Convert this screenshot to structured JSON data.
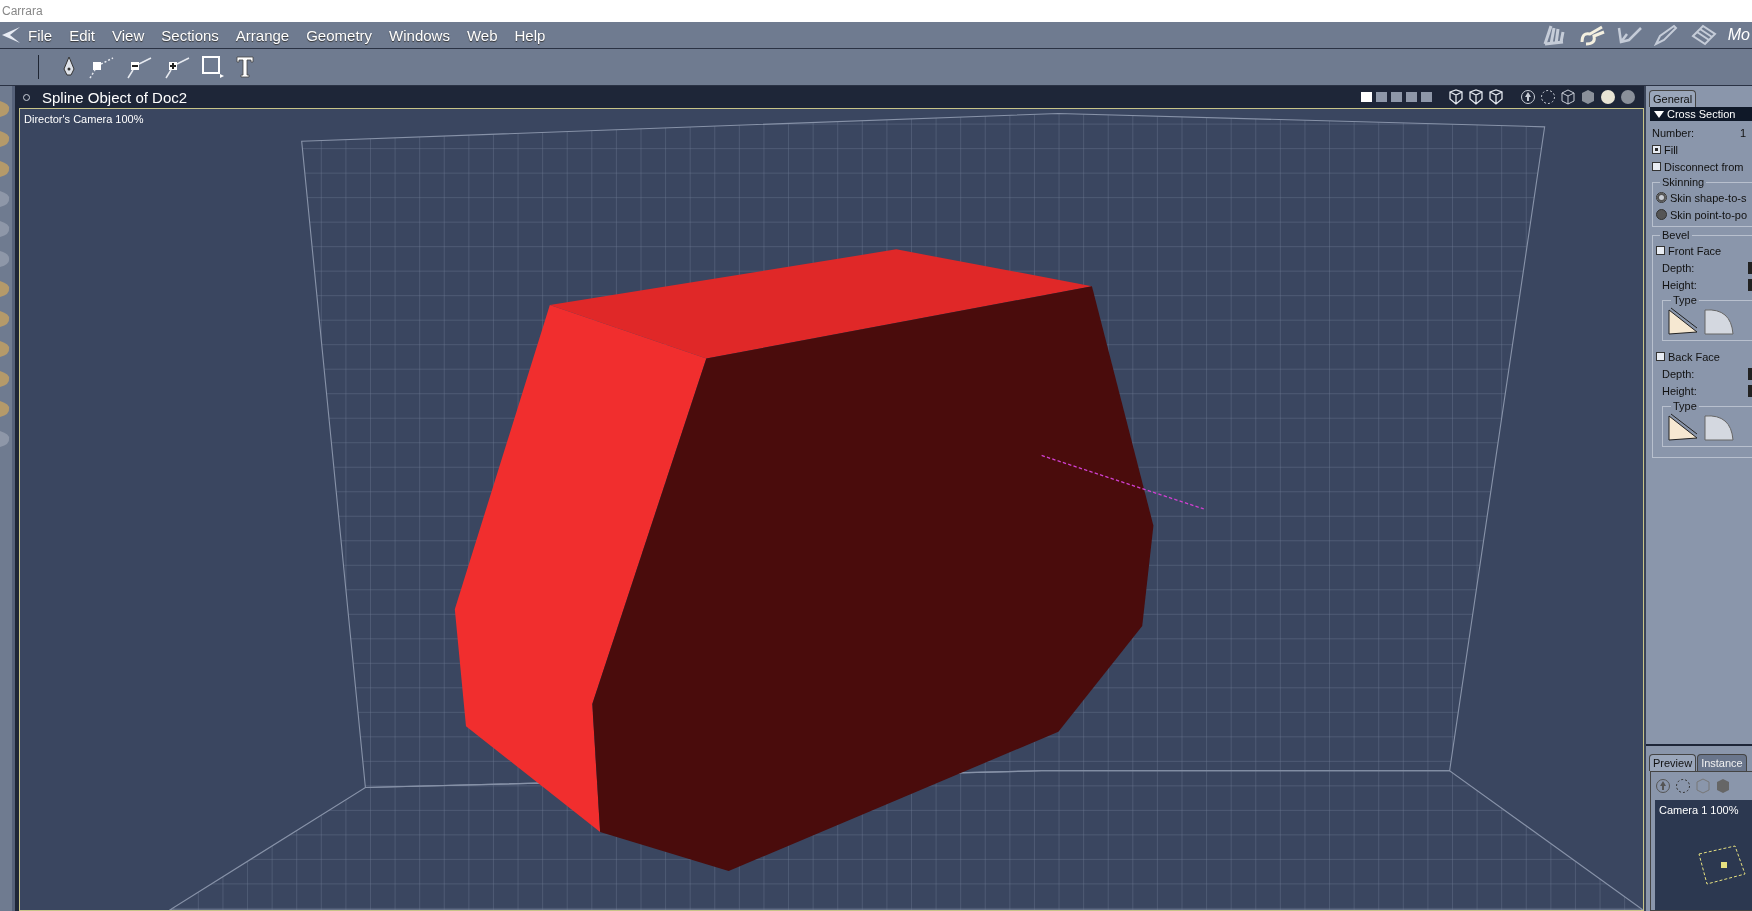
{
  "window": {
    "title": "Carrara"
  },
  "menu": [
    "File",
    "Edit",
    "View",
    "Sections",
    "Arrange",
    "Geometry",
    "Windows",
    "Web",
    "Help"
  ],
  "room_label": "Mo",
  "viewport": {
    "title": "Spline Object of Doc2",
    "camera_label": "Director's Camera 100%",
    "layouts": [
      {
        "selected": true
      },
      {
        "selected": false
      },
      {
        "selected": false
      },
      {
        "selected": false
      },
      {
        "selected": false
      }
    ]
  },
  "panel": {
    "tab": "General",
    "section": {
      "title": "Cross Section",
      "expanded": true
    },
    "number_label": "Number:",
    "number_value": "1",
    "checks": [
      {
        "label": "Fill",
        "checked": true
      },
      {
        "label": "Disconnect from",
        "checked": false
      }
    ],
    "skinning": {
      "title": "Skinning",
      "options": [
        {
          "label": "Skin shape-to-s",
          "selected": true
        },
        {
          "label": "Skin point-to-po",
          "selected": false
        }
      ]
    },
    "bevel": {
      "title": "Bevel",
      "faces": [
        {
          "label": "Front Face",
          "checked": false,
          "depth_label": "Depth:",
          "height_label": "Height:",
          "type_label": "Type"
        },
        {
          "label": "Back Face",
          "checked": false,
          "depth_label": "Depth:",
          "height_label": "Height:",
          "type_label": "Type"
        }
      ]
    }
  },
  "preview": {
    "tabs": [
      {
        "label": "Preview",
        "selected": true
      },
      {
        "label": "Instance",
        "selected": false
      }
    ],
    "camera_label": "Camera 1 100%"
  }
}
